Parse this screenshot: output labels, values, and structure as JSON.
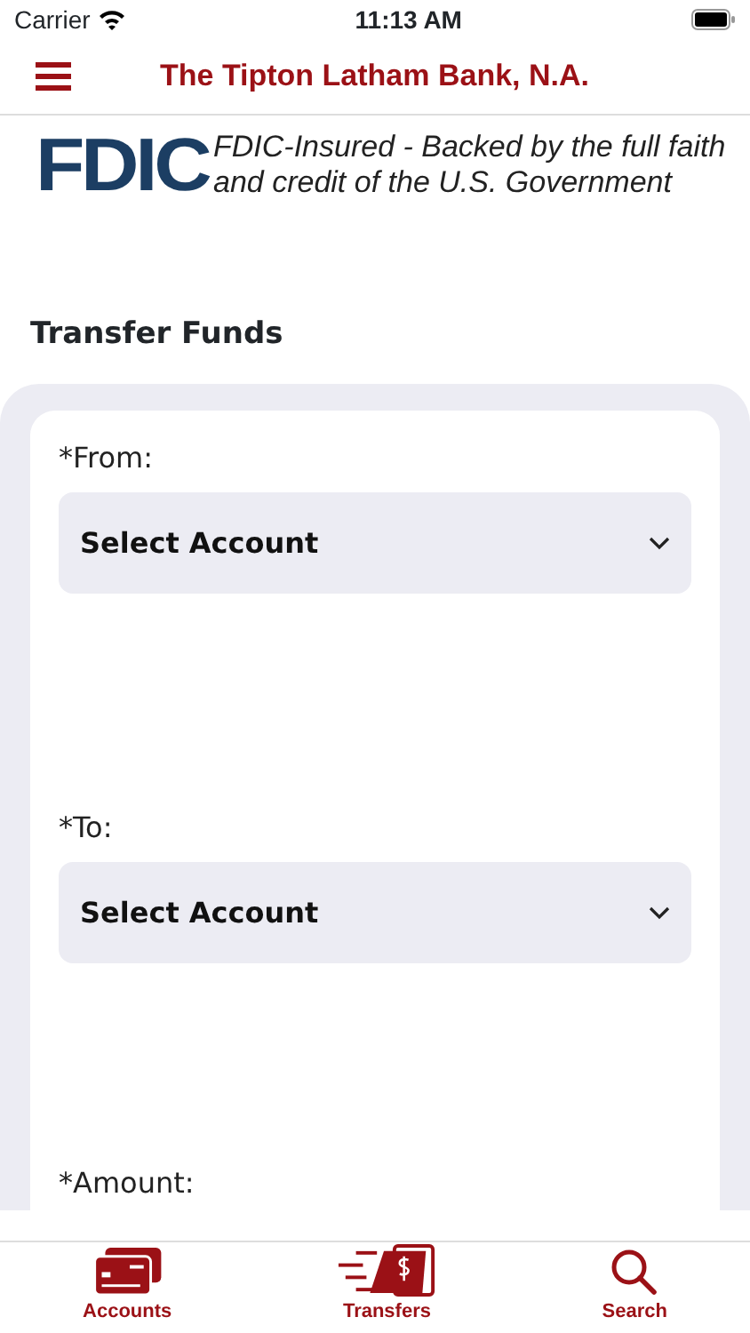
{
  "status_bar": {
    "carrier": "Carrier",
    "time": "11:13 AM"
  },
  "header": {
    "title": "The Tipton Latham Bank, N.A."
  },
  "fdic": {
    "logo": "FDIC",
    "text": "FDIC-Insured - Backed by the full faith and credit of the U.S. Government"
  },
  "page_title": "Transfer Funds",
  "form": {
    "fields": [
      {
        "label": "*From:",
        "value": "Select Account"
      },
      {
        "label": "*To:",
        "value": "Select Account"
      }
    ],
    "amount_label": "*Amount:"
  },
  "tab_bar": [
    {
      "kind": "accounts",
      "label": "Accounts"
    },
    {
      "kind": "transfers",
      "label": "Transfers"
    },
    {
      "kind": "search",
      "label": "Search"
    }
  ]
}
